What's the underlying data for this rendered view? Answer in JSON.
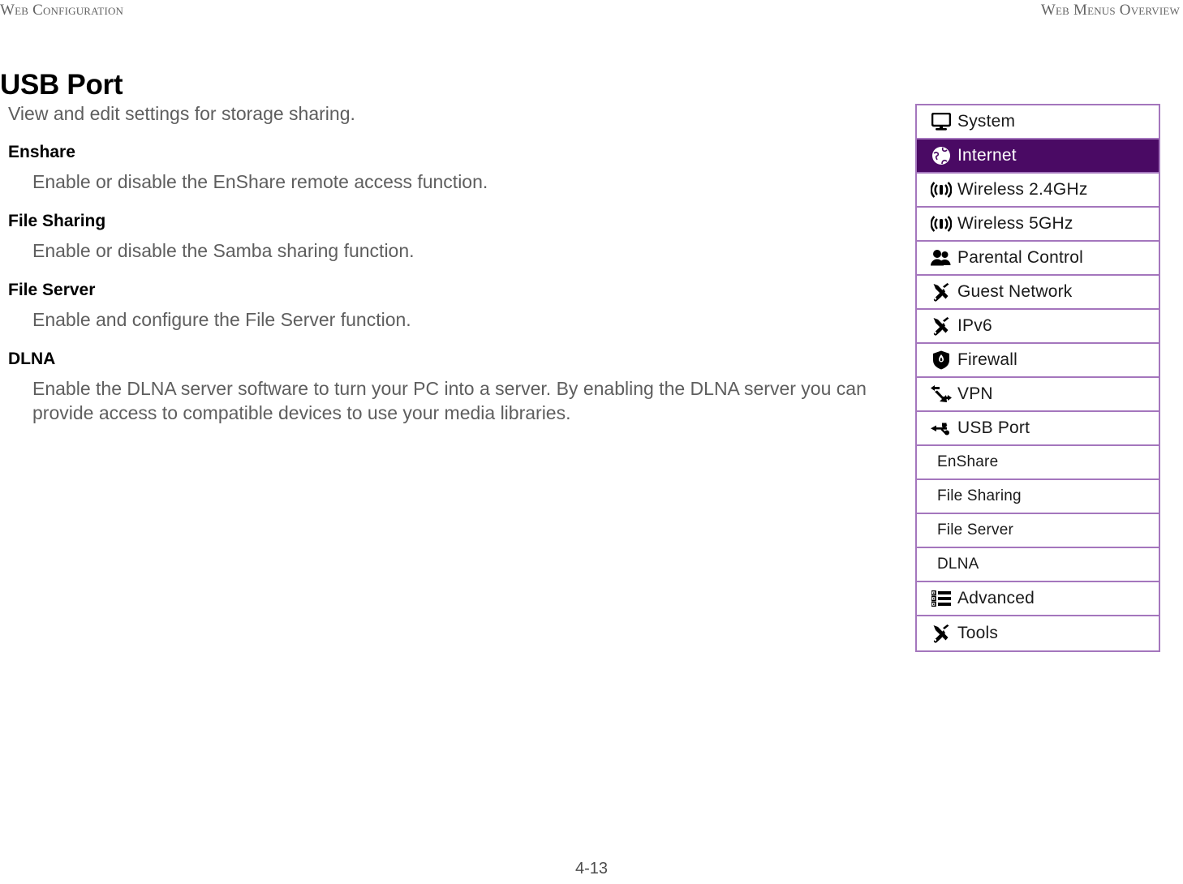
{
  "running_head": {
    "left": "Web Configuration",
    "right": "Web Menus Overview"
  },
  "page_title": "USB Port",
  "content": {
    "intro": "View and edit settings for storage sharing.",
    "sections": [
      {
        "term": "Enshare",
        "description": "Enable or disable the EnShare remote access function."
      },
      {
        "term": "File Sharing",
        "description": "Enable or disable the Samba sharing function."
      },
      {
        "term": "File Server",
        "description": "Enable and configure the File Server function."
      },
      {
        "term": "DLNA",
        "description": "Enable the DLNA server software to turn your PC into a server. By enabling the DLNA server you can provide access to compatible devices to use your media libraries."
      }
    ]
  },
  "menu_figure": {
    "border_color": "#a476bd",
    "selected_color": "#4a0a64",
    "items": [
      {
        "label": "System",
        "icon": "monitor-icon",
        "selected": false,
        "sub": false
      },
      {
        "label": "Internet",
        "icon": "globe-icon",
        "selected": true,
        "sub": false
      },
      {
        "label": "Wireless 2.4GHz",
        "icon": "wireless-icon",
        "selected": false,
        "sub": false
      },
      {
        "label": "Wireless 5GHz",
        "icon": "wireless-icon",
        "selected": false,
        "sub": false
      },
      {
        "label": "Parental Control",
        "icon": "users-icon",
        "selected": false,
        "sub": false
      },
      {
        "label": "Guest Network",
        "icon": "tools-icon",
        "selected": false,
        "sub": false
      },
      {
        "label": "IPv6",
        "icon": "tools-icon",
        "selected": false,
        "sub": false
      },
      {
        "label": "Firewall",
        "icon": "shield-flame-icon",
        "selected": false,
        "sub": false
      },
      {
        "label": "VPN",
        "icon": "arrows-exchange-icon",
        "selected": false,
        "sub": false
      },
      {
        "label": "USB Port",
        "icon": "usb-icon",
        "selected": false,
        "sub": false
      },
      {
        "label": "EnShare",
        "icon": "",
        "selected": false,
        "sub": true
      },
      {
        "label": "File Sharing",
        "icon": "",
        "selected": false,
        "sub": true
      },
      {
        "label": "File Server",
        "icon": "",
        "selected": false,
        "sub": true
      },
      {
        "label": "DLNA",
        "icon": "",
        "selected": false,
        "sub": true
      },
      {
        "label": "Advanced",
        "icon": "list-icon",
        "selected": false,
        "sub": false
      },
      {
        "label": "Tools",
        "icon": "tools-icon",
        "selected": false,
        "sub": false
      }
    ]
  },
  "footer": {
    "page_number": "4-13"
  }
}
